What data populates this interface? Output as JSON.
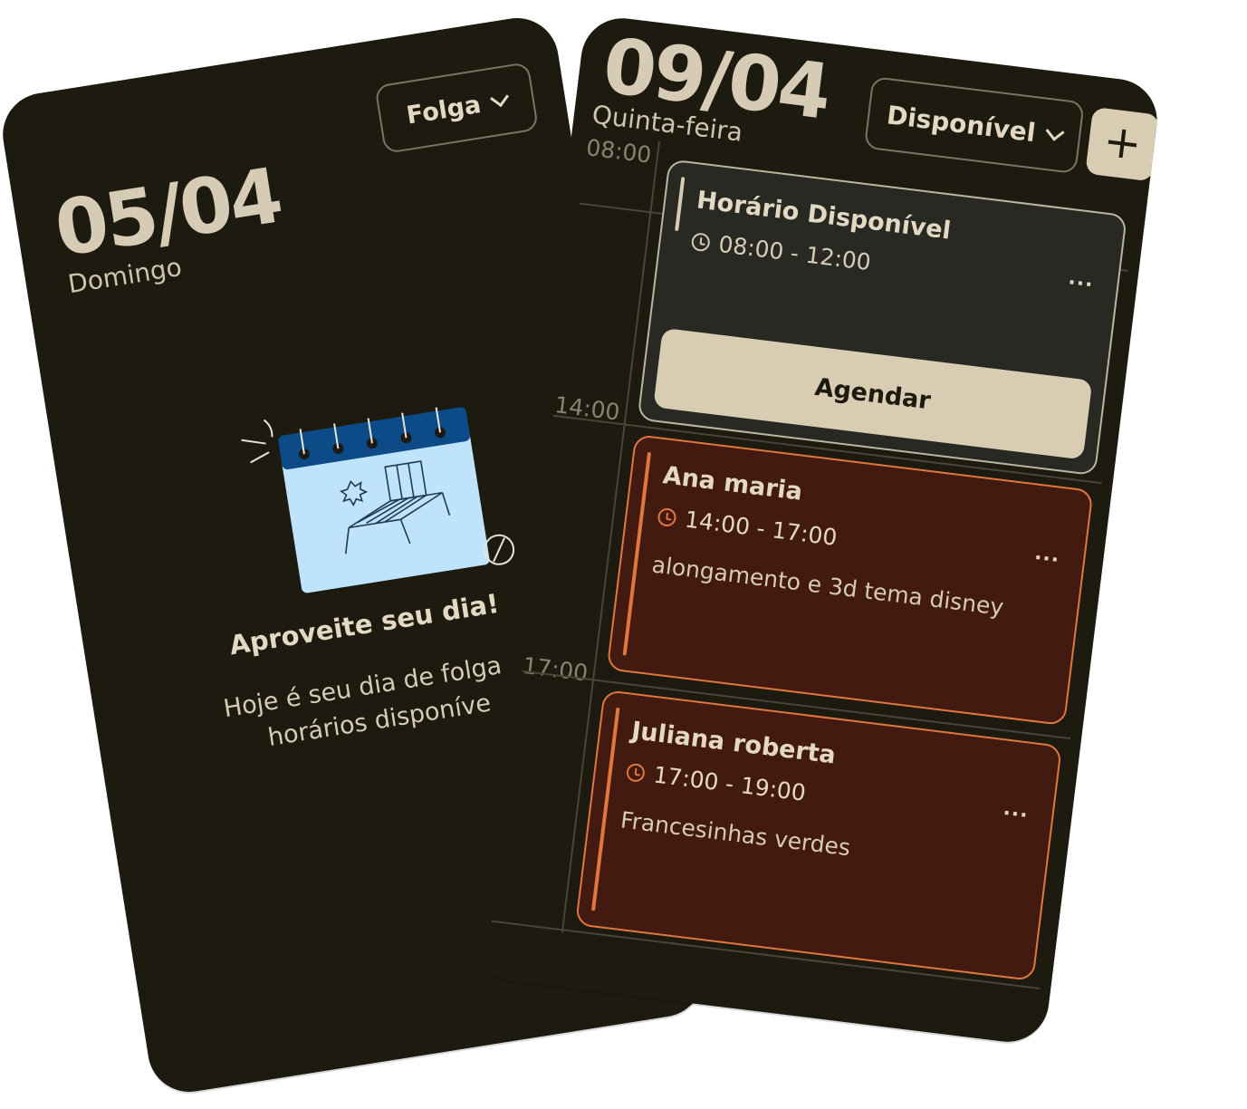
{
  "left_day": {
    "date": "05/04",
    "weekday": "Domingo",
    "status_label": "Folga",
    "empty_state": {
      "title": "Aproveite seu dia!",
      "text_line1": "Hoje é seu dia de folga e",
      "text_line2": "horários disponíve"
    }
  },
  "right_day": {
    "date": "09/04",
    "weekday": "Quinta-feira",
    "status_label": "Disponível",
    "add_label": "+",
    "times": [
      "08:00",
      "14:00",
      "17:00"
    ],
    "events": [
      {
        "title": "Horário Disponível",
        "time": "08:00 - 12:00",
        "more": "...",
        "action_label": "Agendar"
      },
      {
        "title": "Ana maria",
        "time": "14:00 - 17:00",
        "note": "alongamento e 3d tema disney",
        "more": "..."
      },
      {
        "title": "Juliana roberta",
        "time": "17:00 - 19:00",
        "note": "Francesinhas verdes",
        "more": "..."
      }
    ]
  },
  "colors": {
    "card_bg": "#1d1a10",
    "text_primary": "#d6cbb4",
    "accent_orange": "#e0773f",
    "busy_bg": "#431a10",
    "available_bg": "#282923",
    "button_light": "#d8ccb3",
    "illustration_blue": "#bfe3fb"
  }
}
